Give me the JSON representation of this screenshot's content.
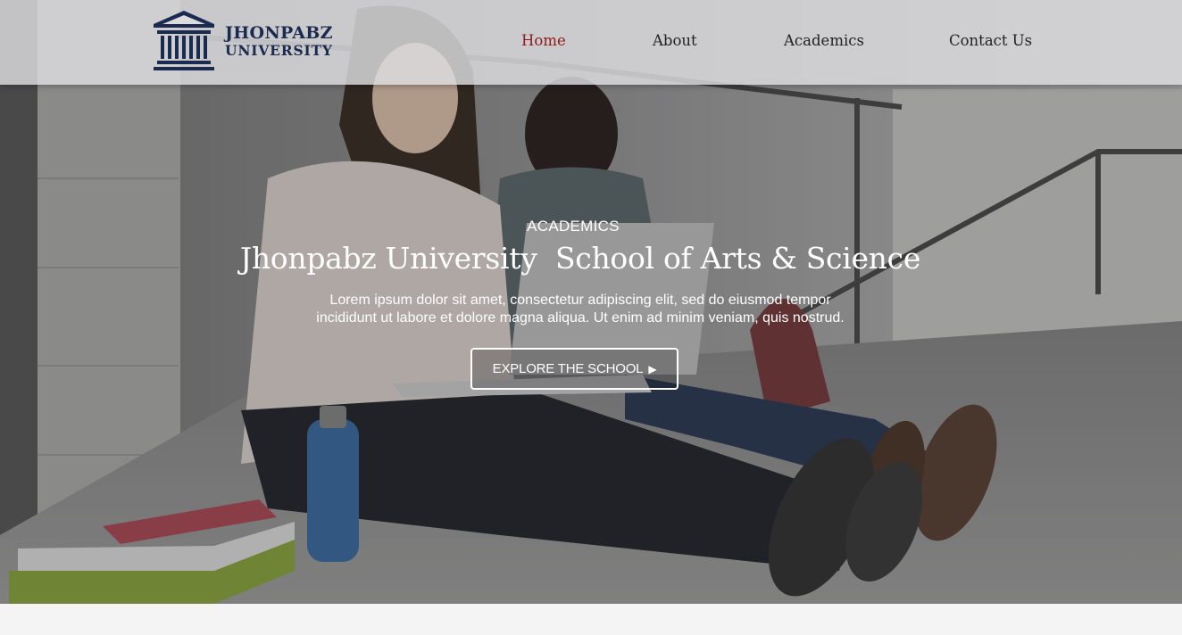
{
  "header": {
    "logo": {
      "line1": "JHONPABZ",
      "line2": "UNIVERSITY",
      "icon": "university-building-icon",
      "color": "#1b2a4f"
    },
    "nav": [
      {
        "label": "Home",
        "active": true
      },
      {
        "label": "About",
        "active": false
      },
      {
        "label": "Academics",
        "active": false
      },
      {
        "label": "Contact Us",
        "active": false
      }
    ],
    "active_color": "#8e1a1a"
  },
  "hero": {
    "kicker": "ACADEMICS",
    "title": "Jhonpabz University  School of Arts & Science",
    "description_line1": "Lorem ipsum dolor sit amet, consectetur adipiscing elit, sed do eiusmod tempor",
    "description_line2": "incididunt ut labore et dolore magna aliqua. Ut enim ad minim veniam, quis nostrud.",
    "button_label": "EXPLORE THE SCHOOL",
    "button_icon": "play-arrow-icon",
    "background": "students-with-laptop-photo"
  }
}
